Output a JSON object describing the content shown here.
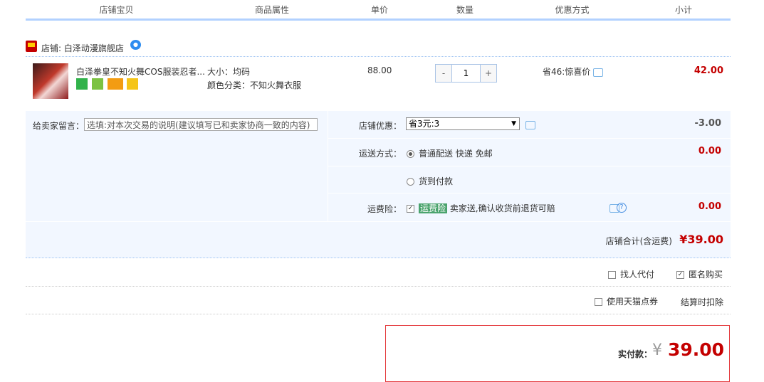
{
  "header": {
    "cols": [
      "店铺宝贝",
      "商品属性",
      "单价",
      "数量",
      "优惠方式",
      "小计"
    ]
  },
  "shop": {
    "label": "店铺: 白泽动漫旗舰店"
  },
  "item": {
    "title": "白泽拳皇不知火舞COS服装忍者...",
    "attr_size": "大小：均码",
    "attr_color": "颜色分类：不知火舞衣服",
    "price": "88.00",
    "quantity_minus": "-",
    "quantity": "1",
    "quantity_plus": "+",
    "promo": "省46:惊喜价",
    "subtotal": "42.00"
  },
  "message": {
    "label": "给卖家留言：",
    "placeholder": "选填:对本次交易的说明(建议填写已和卖家协商一致的内容)"
  },
  "shop_discount": {
    "label": "店铺优惠：",
    "selected": "省3元:3",
    "arrow": "▼",
    "value": "-3.00"
  },
  "shipping": {
    "label": "运送方式：",
    "option1": "普通配送 快递 免邮",
    "option2": "货到付款",
    "value": "0.00"
  },
  "insurance": {
    "label": "运费险：",
    "tag": "运费险",
    "desc": "卖家送,确认收货前退货可赔",
    "help": "?",
    "value": "0.00"
  },
  "shop_total": {
    "label": "店铺合计(含运费)",
    "value": "¥39.00"
  },
  "options": {
    "proxy_pay": "找人代付",
    "anonymous": "匿名购买",
    "tmall_points": "使用天猫点券",
    "deduct_note": "结算时扣除"
  },
  "pay": {
    "label": "实付款：",
    "currency": "¥",
    "amount": "39.00"
  },
  "colors": {
    "accent_red": "#c40000",
    "header_line": "#b2d1ff",
    "panel_bg": "#f2f7ff"
  }
}
